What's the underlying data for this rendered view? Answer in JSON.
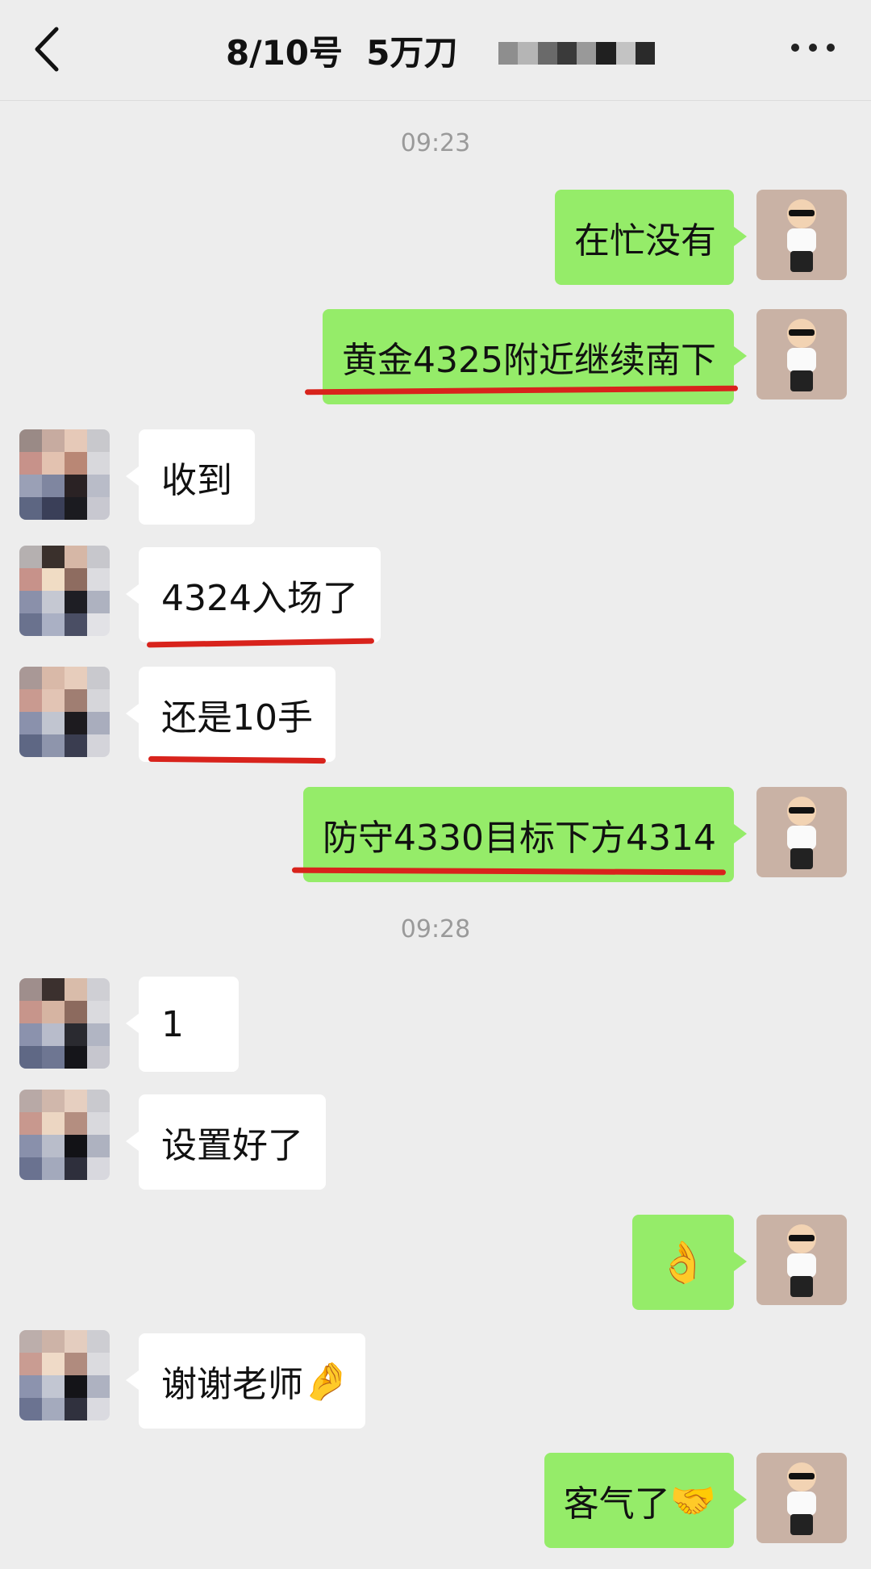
{
  "header": {
    "title": "8/10号  5万刀",
    "back_icon": "chevron-left-icon",
    "more_icon": "more-horizontal-icon"
  },
  "timestamps": [
    "09:23",
    "09:28"
  ],
  "messages": [
    {
      "sender": "me",
      "text": "在忙没有"
    },
    {
      "sender": "me",
      "text": "黄金4325附近继续南下",
      "highlighted": true
    },
    {
      "sender": "contact",
      "text": "收到"
    },
    {
      "sender": "contact",
      "text": "4324入场了",
      "highlighted": true
    },
    {
      "sender": "contact",
      "text": "还是10手",
      "highlighted": true
    },
    {
      "sender": "me",
      "text": "防守4330目标下方4314",
      "highlighted": true
    },
    {
      "sender": "contact",
      "text": "1"
    },
    {
      "sender": "contact",
      "text": "设置好了"
    },
    {
      "sender": "me",
      "text": "👌",
      "emoji": "ok-hand-icon"
    },
    {
      "sender": "contact",
      "text": "谢谢老师",
      "emoji": "pinched-fingers-icon",
      "emoji_char": "🤌"
    },
    {
      "sender": "me",
      "text": "客气了",
      "emoji": "handshake-icon",
      "emoji_char": "🤝"
    }
  ],
  "colors": {
    "background": "#ededed",
    "my_bubble": "#95ec69",
    "their_bubble": "#ffffff",
    "highlight_line": "#d8231c",
    "timestamp": "#9a9a9a"
  }
}
